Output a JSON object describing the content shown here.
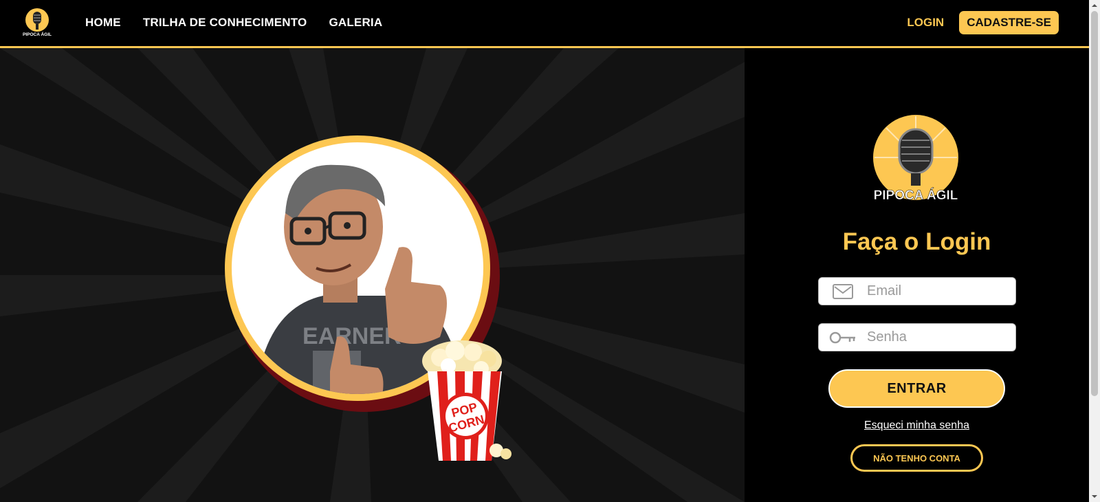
{
  "nav": {
    "logo_text": "PIPOCA ÁGIL",
    "links": [
      "HOME",
      "TRILHA DE CONHECIMENTO",
      "GALERIA"
    ],
    "login_label": "LOGIN",
    "signup_label": "CADASTRE-SE"
  },
  "hero": {
    "shirt_text": "EARNER",
    "popcorn_text_top": "POP",
    "popcorn_text_bottom": "CORN"
  },
  "login": {
    "logo_text": "PIPOCA ÁGIL",
    "title": "Faça o Login",
    "email_placeholder": "Email",
    "password_placeholder": "Senha",
    "submit_label": "ENTRAR",
    "forgot_label": "Esqueci minha senha",
    "no_account_label": "NÃO TENHO CONTA"
  },
  "colors": {
    "accent": "#fdc752",
    "background": "#000000",
    "hero_bg": "#121212",
    "dark_red": "#6b0d12"
  },
  "icons": {
    "email": "envelope-icon",
    "password": "key-icon",
    "logo": "microphone-icon"
  }
}
